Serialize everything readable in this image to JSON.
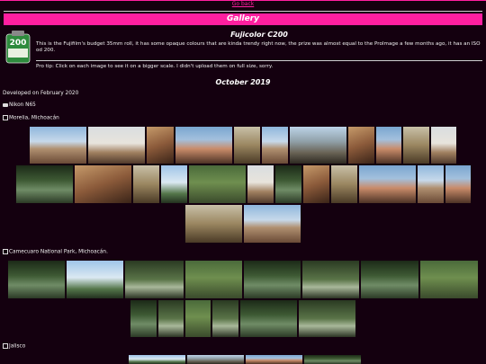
{
  "nav": {
    "go_back": "Go back"
  },
  "header": {
    "title": "Gallery"
  },
  "film": {
    "icon_text": "200",
    "title": "Fujicolor C200",
    "description": "This is the Fujifilm's budget 35mm roll, it has some opaque colours that are kinda trendy right now, the prize was almost equal to the ProImage a few months ago, it has an ISO od 200.",
    "pro_tip": "Pro tip: Click on each image to see it on a bigger scale. I didn't upload them on full size, sorry."
  },
  "roll": {
    "month": "October 2019",
    "developed": "Developed on February 2020",
    "camera": "Nikon N65"
  },
  "sections": [
    {
      "label": "Morelia, Michoacán"
    },
    {
      "label": "Camecuaro National Park, Michoacán."
    },
    {
      "label": "Jalisco"
    }
  ],
  "colors": {
    "accent": "#ff1fa0",
    "background": "#14000f"
  }
}
